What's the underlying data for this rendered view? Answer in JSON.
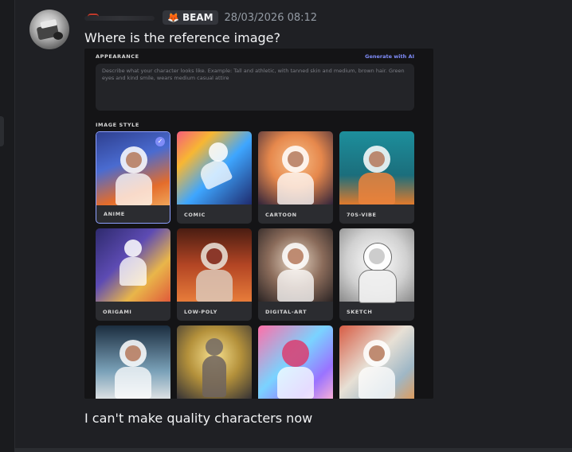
{
  "message": {
    "tag": "BEAM",
    "timestamp": "28/03/2026 08:12",
    "text_1": "Where is the reference image?",
    "text_2": "I can't make quality characters now"
  },
  "embed": {
    "appearance_label": "APPEARANCE",
    "generate_label": "Generate with AI",
    "description_placeholder": "Describe what your character looks like. Example: Tall and athletic, with tanned skin and medium, brown hair. Green eyes and kind smile, wears medium casual attire",
    "image_style_label": "IMAGE STYLE",
    "styles": [
      {
        "label": "ANIME",
        "selected": true
      },
      {
        "label": "COMIC"
      },
      {
        "label": "CARTOON"
      },
      {
        "label": "70S-VIBE"
      },
      {
        "label": "ORIGAMI"
      },
      {
        "label": "LOW-POLY"
      },
      {
        "label": "DIGITAL-ART"
      },
      {
        "label": "SKETCH"
      },
      {
        "label": ""
      },
      {
        "label": ""
      },
      {
        "label": ""
      },
      {
        "label": ""
      }
    ]
  },
  "colors": {
    "background": "#1f2024",
    "accent": "#7f8cf8",
    "tag_icon": "#f0a020"
  },
  "icons": {
    "tag": "fox-icon",
    "selected": "checkmark-icon"
  }
}
